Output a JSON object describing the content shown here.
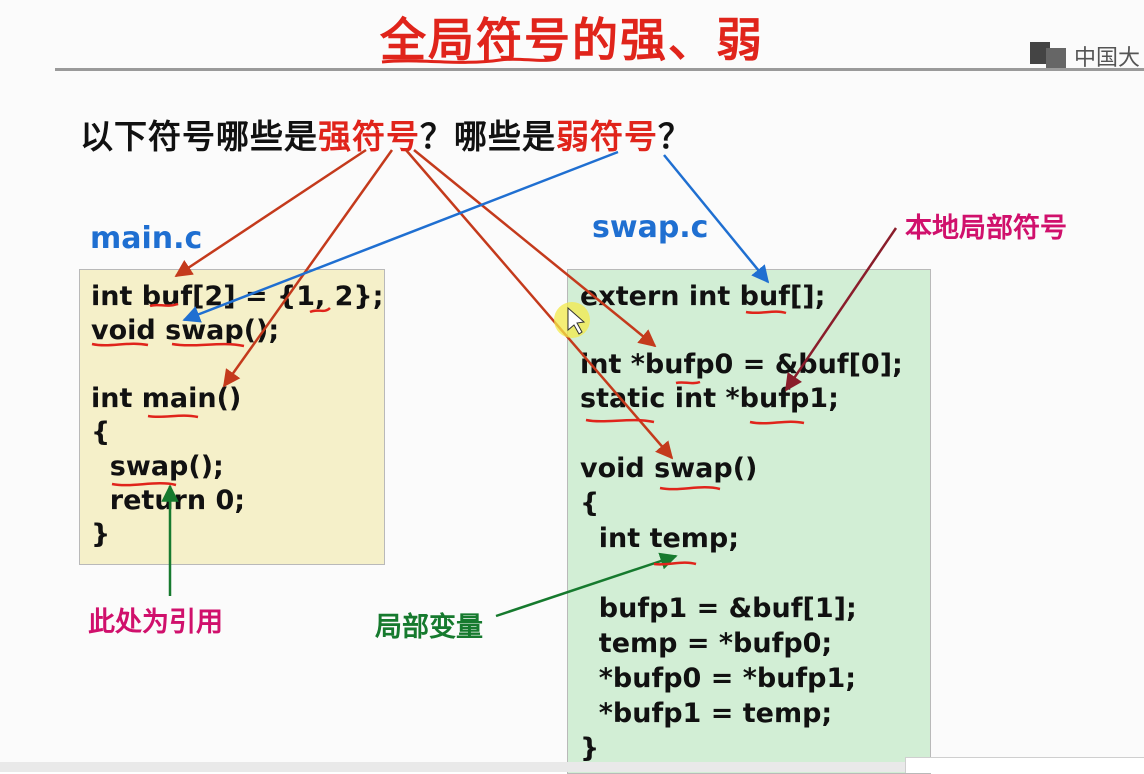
{
  "slide": {
    "title": "全局符号的强、弱",
    "logo_text": "中国大",
    "question": {
      "part1": "以下符号哪些是",
      "strong": "强符号",
      "part2": "？哪些是",
      "weak": "弱符号",
      "part3": "？"
    }
  },
  "main_c": {
    "filename": "main.c",
    "lines": [
      "int buf[2] = {1, 2};",
      "void swap();",
      "",
      "int main()",
      "{",
      "  swap();",
      "  return 0;",
      "}"
    ]
  },
  "swap_c": {
    "filename": "swap.c",
    "lines": [
      "extern int buf[];",
      "",
      "int *bufp0 = &buf[0];",
      "static int *bufp1;",
      "",
      "void swap()",
      "{",
      "  int temp;",
      "",
      "  bufp1 = &buf[1];",
      "  temp = *bufp0;",
      "  *bufp0 = *bufp1;",
      "  *bufp1 = temp;",
      "}"
    ]
  },
  "annotations": {
    "reference": "此处为引用",
    "local_variable": "局部变量",
    "local_symbol": "本地局部符号"
  },
  "colors": {
    "strong_arrow": "#c43a1c",
    "weak_arrow": "#1f6fd1",
    "annotation_pink": "#d0106c",
    "annotation_green": "#167a2e",
    "main_box_bg": "#f5f0c9",
    "swap_box_bg": "#d2eed5"
  }
}
